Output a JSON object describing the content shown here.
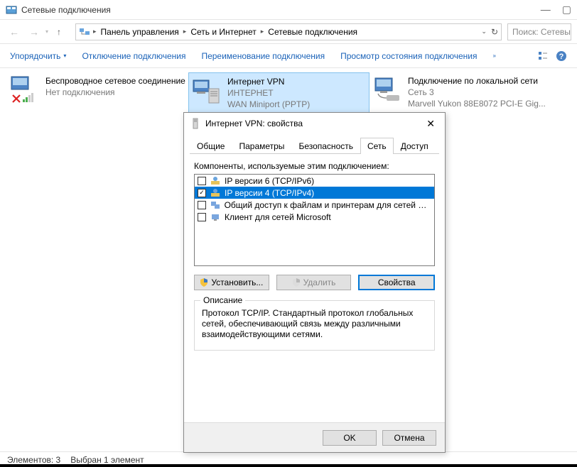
{
  "titlebar": {
    "title": "Сетевые подключения"
  },
  "breadcrumb": {
    "p0": "Панель управления",
    "p1": "Сеть и Интернет",
    "p2": "Сетевые подключения"
  },
  "search": {
    "placeholder": "Поиск: Сетевые п"
  },
  "cmdbar": {
    "organize": "Упорядочить",
    "disable": "Отключение подключения",
    "rename": "Переименование подключения",
    "view_status": "Просмотр состояния подключения"
  },
  "connections": {
    "c0": {
      "name": "Беспроводное сетевое соединение",
      "sub1": "",
      "sub2": "Нет подключения"
    },
    "c1": {
      "name": "Интернет  VPN",
      "sub1": "ИНТЕРНЕТ",
      "sub2": "WAN Miniport (PPTP)"
    },
    "c2": {
      "name": "Подключение по локальной сети",
      "sub1": "Сеть 3",
      "sub2": "Marvell Yukon 88E8072 PCI-E Gig..."
    }
  },
  "statusbar": {
    "count": "Элементов: 3",
    "selected": "Выбран 1 элемент"
  },
  "dialog": {
    "title": "Интернет VPN: свойства",
    "tabs": {
      "t0": "Общие",
      "t1": "Параметры",
      "t2": "Безопасность",
      "t3": "Сеть",
      "t4": "Доступ"
    },
    "components_label": "Компоненты, используемые этим подключением:",
    "items": {
      "i0": "IP версии 6 (TCP/IPv6)",
      "i1": "IP версии 4 (TCP/IPv4)",
      "i2": "Общий доступ к файлам и принтерам для сетей Micr...",
      "i3": "Клиент для сетей Microsoft"
    },
    "buttons": {
      "install": "Установить...",
      "uninstall": "Удалить",
      "props": "Свойства"
    },
    "desc_title": "Описание",
    "desc_text": "Протокол TCP/IP. Стандартный протокол глобальных сетей, обеспечивающий связь между различными взаимодействующими сетями.",
    "ok": "OK",
    "cancel": "Отмена"
  }
}
